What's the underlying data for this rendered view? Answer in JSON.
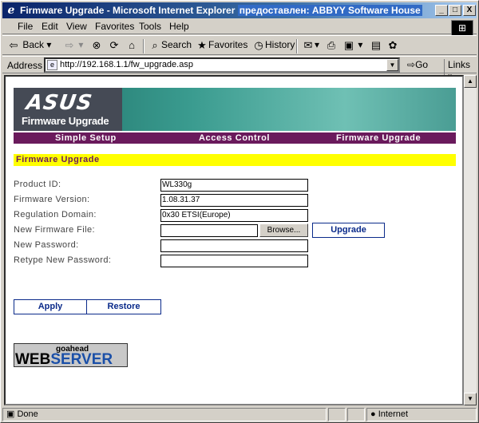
{
  "window": {
    "title_prefix": "Firmware Upgrade - Microsoft Internet Explorer ",
    "title_selected": "предоставлен: ABBYY Software House",
    "minimize": "_",
    "maximize": "□",
    "close": "X"
  },
  "menu": [
    "File",
    "Edit",
    "View",
    "Favorites",
    "Tools",
    "Help"
  ],
  "toolbar": {
    "back": "Back",
    "search": "Search",
    "favorites": "Favorites",
    "history": "History"
  },
  "address": {
    "label": "Address",
    "url": "http://192.168.1.1/fw_upgrade.asp",
    "go": "Go",
    "links": "Links"
  },
  "page": {
    "logo_brand": "ASUS",
    "logo_sub": "Firmware Upgrade",
    "nav": {
      "simple_setup": "Simple Setup",
      "access_control": "Access Control",
      "firmware_upgrade": "Firmware Upgrade"
    },
    "section_title": "Firmware Upgrade",
    "fields": {
      "product_id_label": "Product ID:",
      "product_id_value": "WL330g",
      "firmware_version_label": "Firmware Version:",
      "firmware_version_value": "1.08.31.37",
      "regulation_label": "Regulation Domain:",
      "regulation_value": "0x30 ETSI(Europe)",
      "new_fw_label": "New Firmware File:",
      "new_fw_value": "",
      "new_password_label": "New Password:",
      "new_password_value": "",
      "retype_password_label": "Retype New Password:",
      "retype_password_value": ""
    },
    "browse_label": "Browse...",
    "upgrade_label": "Upgrade",
    "apply_label": "Apply",
    "restore_label": "Restore",
    "goahead_top": "goahead",
    "goahead_web": "WEB",
    "goahead_server": "SERVER"
  },
  "status": {
    "text": "Done",
    "zone": "Internet"
  },
  "colors": {
    "nav_bg": "#6a1a5c",
    "section_bg": "#ffff00",
    "title_bar": "#0a246a",
    "banner": "#3a9b8f"
  }
}
